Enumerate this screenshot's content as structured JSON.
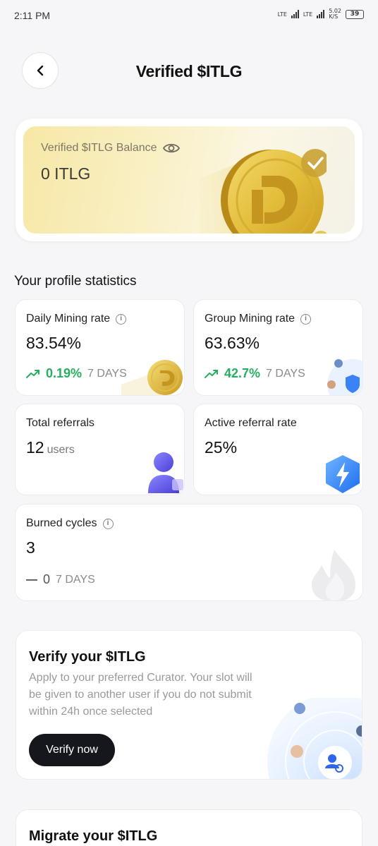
{
  "status_bar": {
    "time": "2:11 PM",
    "network_1": "LTE",
    "network_2": "LTE",
    "speed": "5.02",
    "speed_unit": "K/S",
    "battery": "39"
  },
  "header": {
    "title": "Verified $ITLG"
  },
  "balance": {
    "label": "Verified $ITLG Balance",
    "value": "0 ITLG"
  },
  "stats_section": {
    "title": "Your profile statistics"
  },
  "stats": {
    "daily": {
      "label": "Daily Mining rate",
      "value": "83.54%",
      "trend": "0.19%",
      "period": "7 DAYS"
    },
    "group": {
      "label": "Group Mining rate",
      "value": "63.63%",
      "trend": "42.7%",
      "period": "7 DAYS"
    },
    "referrals": {
      "label": "Total referrals",
      "value": "12",
      "unit": "users"
    },
    "active": {
      "label": "Active referral rate",
      "value": "25%"
    },
    "burned": {
      "label": "Burned cycles",
      "value": "3",
      "trend": "0",
      "period": "7 DAYS"
    }
  },
  "verify": {
    "title": "Verify your $ITLG",
    "description": "Apply to your preferred Curator. Your slot will be given to another user if you do not submit within 24h once selected",
    "button": "Verify now"
  },
  "migrate": {
    "title": "Migrate your $ITLG"
  },
  "colors": {
    "trend_up": "#27ae60",
    "button_dark": "#15171c",
    "balance_gold": "#f7e8a6"
  }
}
